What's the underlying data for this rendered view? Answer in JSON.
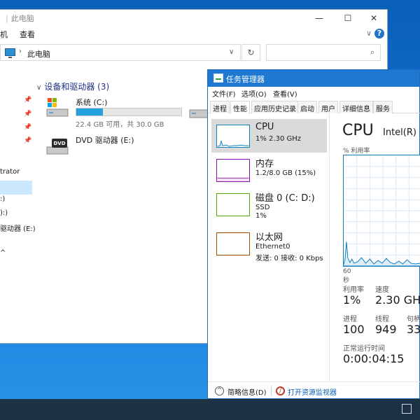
{
  "explorer": {
    "title": "此电脑",
    "window_controls": {
      "minimize": "—",
      "maximize": "☐",
      "close": "✕"
    },
    "ribbon": {
      "tab_computer": "机",
      "tab_view": "查看",
      "help": "?",
      "expand": "∨"
    },
    "address": {
      "separator": "›",
      "path": "此电脑",
      "dropdown": "∨",
      "refresh": "↻"
    },
    "search": {
      "placeholder": "",
      "icon": "search-icon"
    },
    "nav": {
      "items": [
        "trator",
        ":)",
        "):)",
        "驱动器 (E:)",
        "^"
      ]
    },
    "group_header": "设备和驱动器 (3)",
    "drives": [
      {
        "name": "系统 (C:)",
        "free_text": "22.4 GB 可用，共 30.0 GB",
        "used_fraction": 0.253
      },
      {
        "name": "DVD 驱动器 (E:)"
      }
    ]
  },
  "taskmgr": {
    "title": "任务管理器",
    "menu": [
      "文件(F)",
      "选项(O)",
      "查看(V)"
    ],
    "tabs": [
      "进程",
      "性能",
      "应用历史记录",
      "启动",
      "用户",
      "详细信息",
      "服务"
    ],
    "active_tab": "性能",
    "resources": [
      {
        "name": "CPU",
        "sub1": "1% 2.30 GHz",
        "sub2": "",
        "color": "#117dbb"
      },
      {
        "name": "内存",
        "sub1": "1.2/8.0 GB (15%)",
        "sub2": "",
        "color": "#8b12ae"
      },
      {
        "name": "磁盘 0 (C: D:)",
        "sub1": "SSD",
        "sub2": "1%",
        "color": "#4da60c"
      },
      {
        "name": "以太网",
        "sub1": "Ethernet0",
        "sub2": "发送: 0 接收: 0 Kbps",
        "color": "#a74f01"
      }
    ],
    "detail": {
      "title": "CPU",
      "model": "Intel(R) C",
      "util_label": "% 利用率",
      "time_label": "60 秒",
      "utilization_label": "利用率",
      "utilization_value": "1%",
      "speed_label": "速度",
      "speed_value": "2.30 GHz",
      "processes_label": "进程",
      "processes_value": "100",
      "threads_label": "线程",
      "threads_value": "949",
      "handles_label": "句柄",
      "handles_value": "33",
      "uptime_label": "正常运行时间",
      "uptime_value": "0:00:04:15"
    },
    "footer": {
      "less": "简略信息(D)",
      "resmon": "打开资源监视器"
    }
  },
  "colors": {
    "accent": "#1f78d1",
    "cpu_graph": "#117dbb"
  }
}
